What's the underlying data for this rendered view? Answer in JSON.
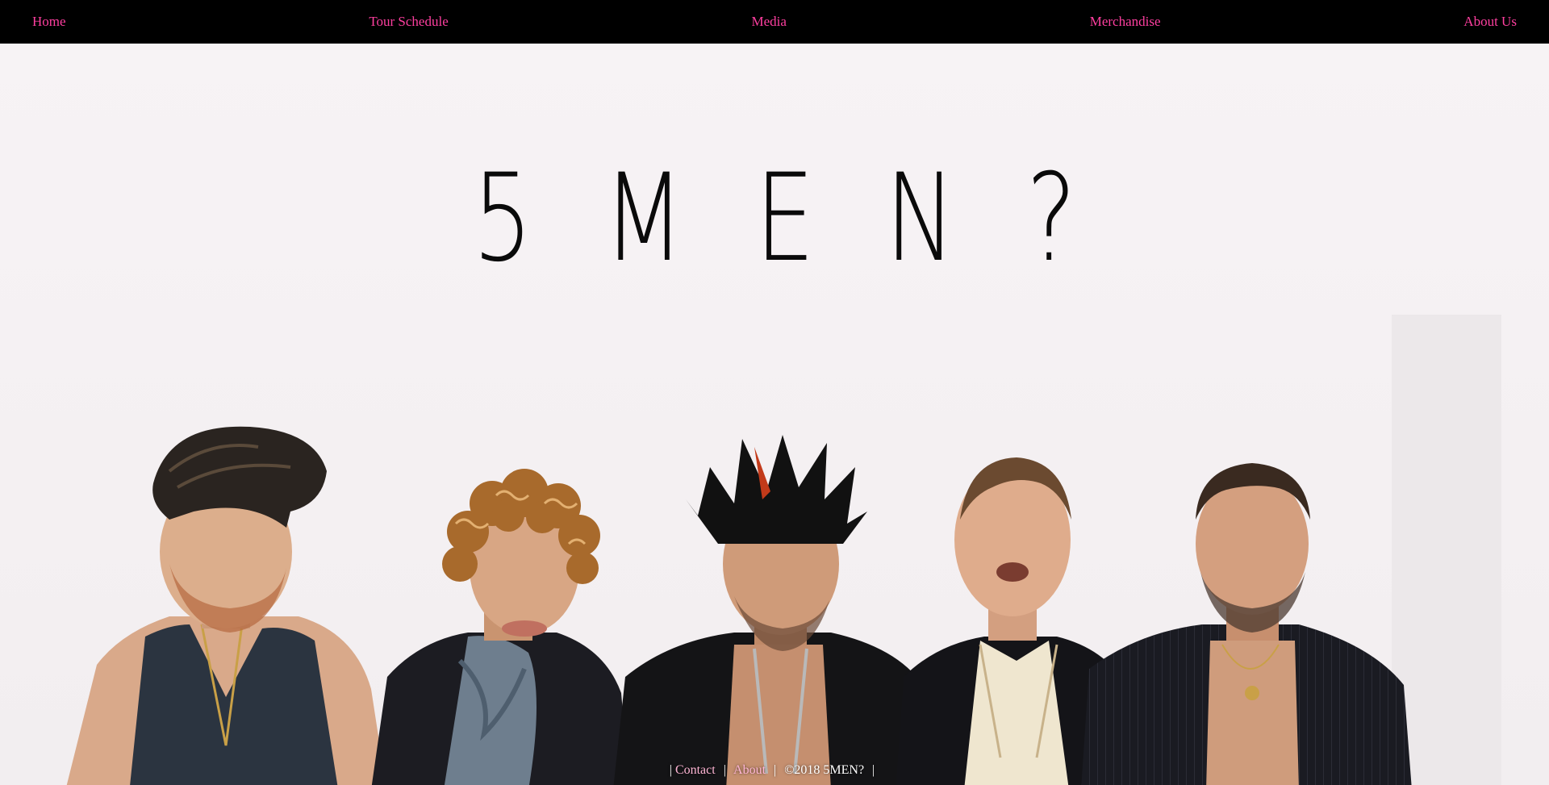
{
  "nav": {
    "items": [
      {
        "label": "Home"
      },
      {
        "label": "Tour Schedule"
      },
      {
        "label": "Media"
      },
      {
        "label": "Merchandise"
      },
      {
        "label": "About Us"
      }
    ]
  },
  "hero": {
    "title": "5MEN?"
  },
  "footer": {
    "sep": "|",
    "contact": "Contact",
    "about": "About",
    "copyright": "©2018 5MEN?"
  },
  "colors": {
    "nav_background": "#000000",
    "nav_link": "#ff3fa0",
    "page_background": "#f5f0f2",
    "footer_link": "#ffb6d5"
  }
}
